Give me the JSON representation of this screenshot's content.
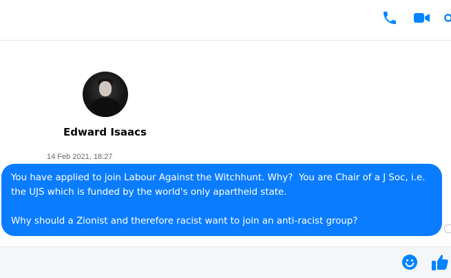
{
  "contact": {
    "name": "Edward Isaacs"
  },
  "message": {
    "timestamp": "14 Feb 2021, 18:27",
    "paragraph_1": "You have applied to join Labour Against the Witchhunt. Why?  You are Chair of a J Soc, i.e. the UJS which is funded by the world's only apartheid state.",
    "paragraph_2": "Why should a Zionist and therefore racist want to join an anti-racist group?"
  },
  "icons": {
    "call": "phone-icon",
    "video": "video-camera-icon",
    "info": "info-icon",
    "emoji": "emoji-icon",
    "like": "thumbs-up-icon"
  },
  "colors": {
    "accent": "#0a7cff",
    "icon_blue": "#0084ff"
  }
}
